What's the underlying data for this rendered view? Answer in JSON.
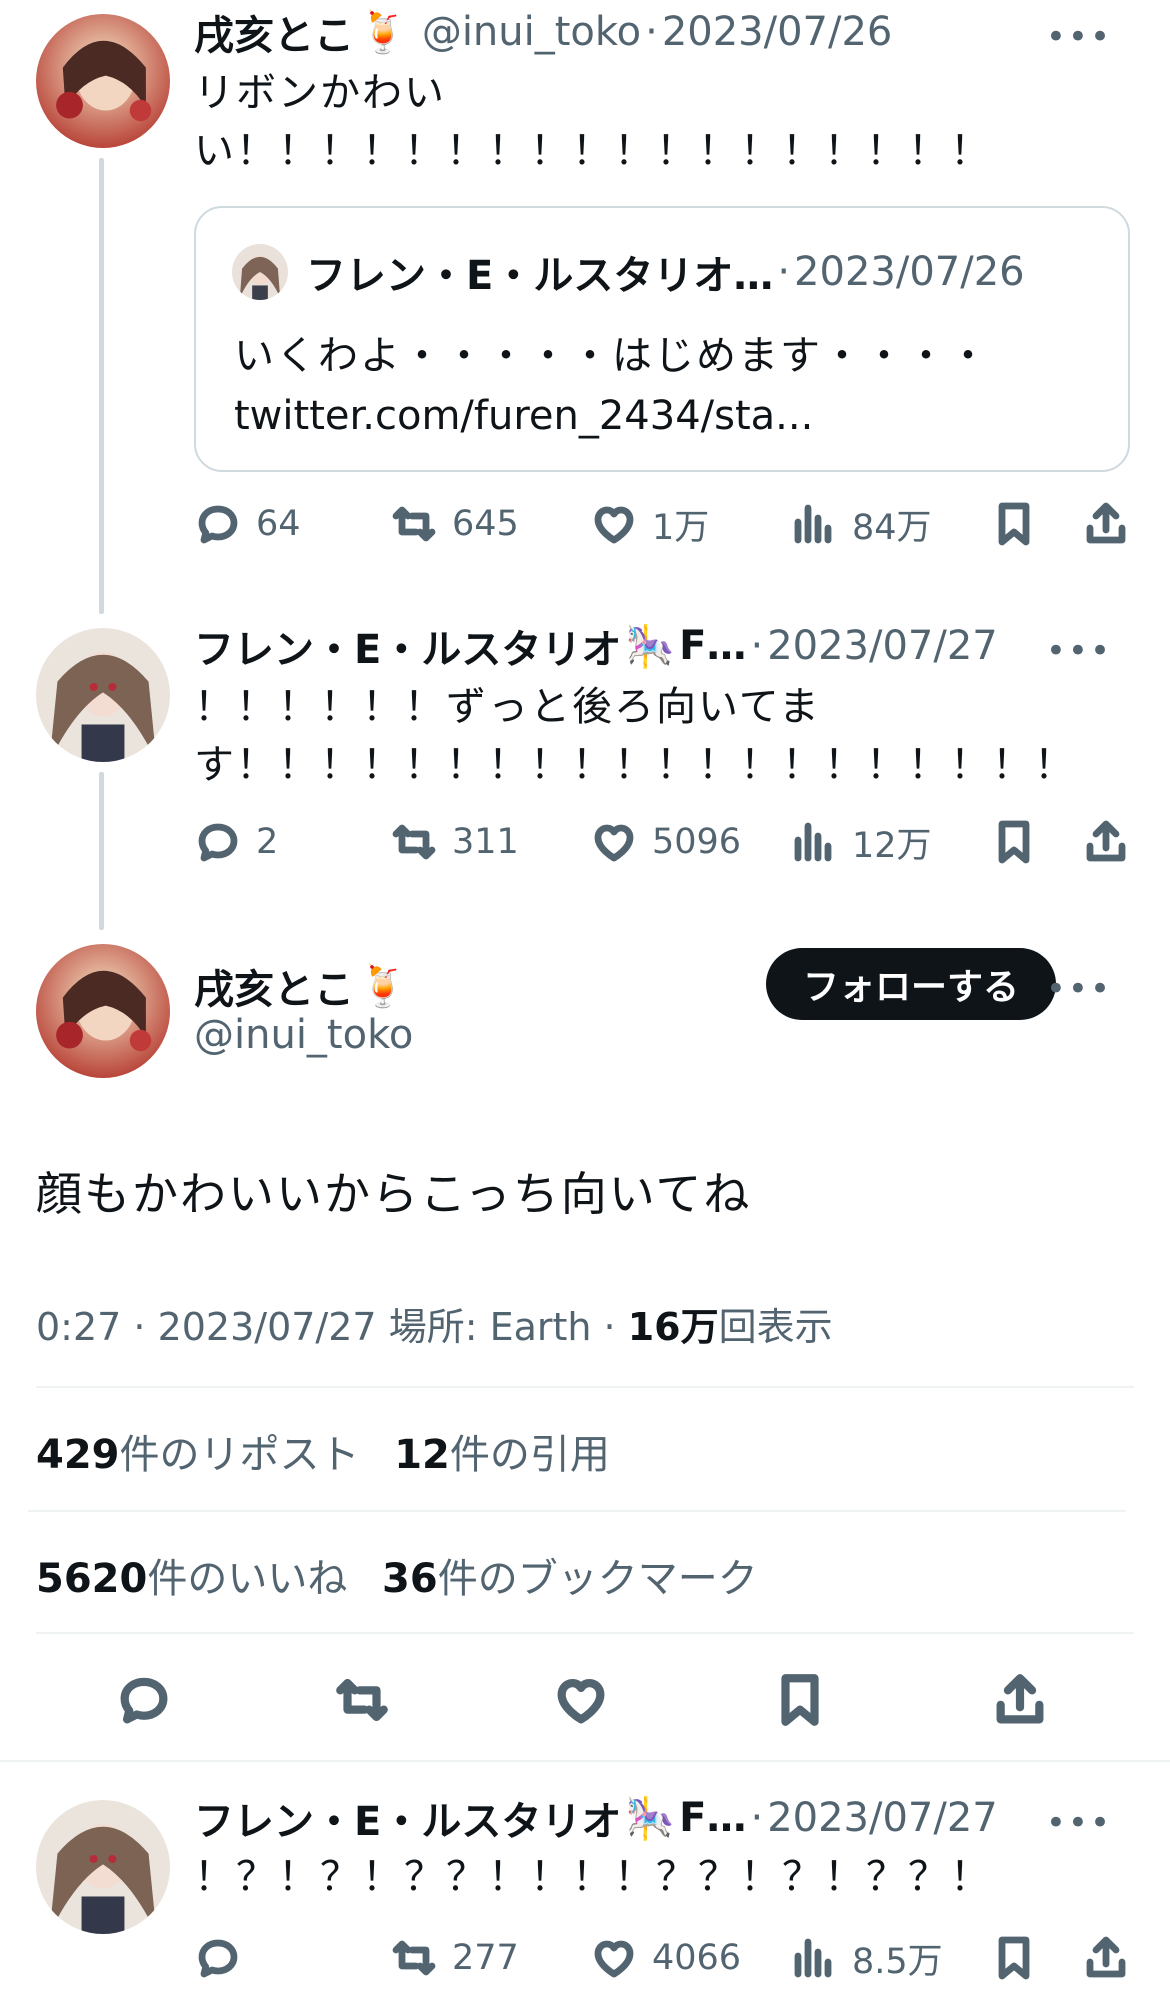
{
  "posts": [
    {
      "name": "戌亥とこ",
      "emoji": "🍹",
      "handle": "@inui_toko",
      "date": "2023/07/26",
      "text_line1": "リボンかわい",
      "text_line2": "い！！！！！！！！！！！！！！！！！！",
      "quote": {
        "name": "フレン・E・ルスタリオ…",
        "date": "2023/07/26",
        "line1": "いくわよ・・・・・はじめます・・・・",
        "line2": "twitter.com/furen_2434/sta..."
      },
      "replies": "64",
      "reposts": "645",
      "likes": "1万",
      "views": "84万"
    },
    {
      "name": "フレン・E・ルスタリオ",
      "emoji": "🎠",
      "name_suffix": "F…",
      "date": "2023/07/27",
      "text_line1": "！！！！！！ずっと後ろ向いてま",
      "text_line2": "す！！！！！！！！！！！！！！！！！！！！",
      "replies": "2",
      "reposts": "311",
      "likes": "5096",
      "views": "12万"
    }
  ],
  "main_post": {
    "name": "戌亥とこ",
    "emoji": "🍹",
    "handle": "@inui_toko",
    "follow_label": "フォローする",
    "text": "顔もかわいいからこっち向いてね",
    "time": "0:27 · 2023/07/27",
    "location": "場所: Earth ·",
    "views_count": "16万",
    "views_label": "回表示",
    "reposts_count": "429",
    "reposts_label": "件のリポスト",
    "quotes_count": "12",
    "quotes_label": "件の引用",
    "likes_count": "5620",
    "likes_label": "件のいいね",
    "bookmarks_count": "36",
    "bookmarks_label": "件のブックマーク"
  },
  "reply": {
    "name": "フレン・E・ルスタリオ",
    "emoji": "🎠",
    "name_suffix": "F…",
    "date": "2023/07/27",
    "text": "！？！？！？？！！！！？？！？！？？！",
    "replies": "",
    "reposts": "277",
    "likes": "4066",
    "views": "8.5万"
  },
  "colors": {
    "text": "#0f1419",
    "muted": "#536471",
    "border": "#cfd9de",
    "button_bg": "#0f1419"
  },
  "icons": [
    "reply-icon",
    "repost-icon",
    "like-icon",
    "views-icon",
    "bookmark-icon",
    "share-icon",
    "more-icon"
  ]
}
